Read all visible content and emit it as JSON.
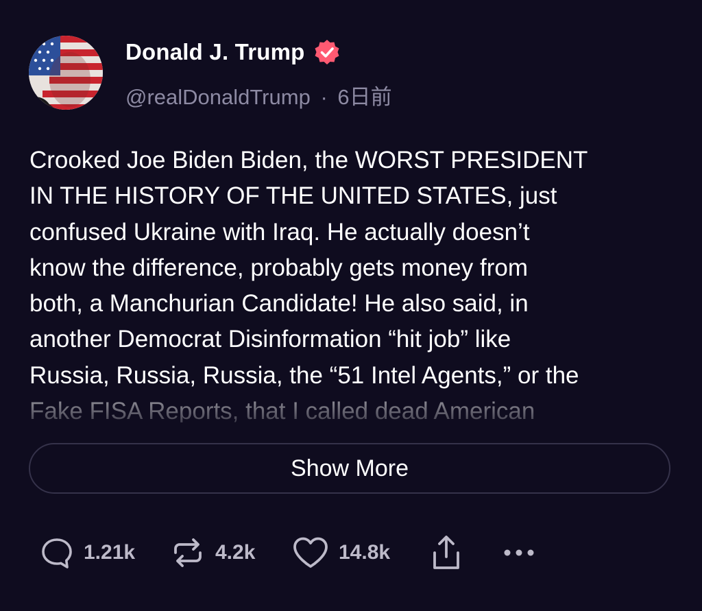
{
  "post": {
    "author_name": "Donald J. Trump",
    "handle": "@realDonaldTrump",
    "separator": "·",
    "time": "6日前",
    "body": "Crooked Joe Biden Biden, the WORST PRESIDENT\nIN THE HISTORY OF THE UNITED STATES, just\nconfused Ukraine with Iraq. He actually doesn’t\nknow the difference, probably gets money from\nboth, a Manchurian Candidate! He also said, in\nanother Democrat Disinformation “hit job” like\nRussia, Russia, Russia, the “51 Intel Agents,” or the\nFake FISA Reports, that I called dead American",
    "show_more_label": "Show More"
  },
  "actions": {
    "replies": "1.21k",
    "reposts": "4.2k",
    "likes": "14.8k"
  },
  "icons": {
    "verified": "verified-badge-icon",
    "reply": "comment-icon",
    "repost": "repost-icon",
    "like": "heart-icon",
    "share": "share-icon",
    "more": "more-dots-icon"
  },
  "colors": {
    "background": "#0f0c1f",
    "verified": "#ff5a72",
    "muted": "#8d8aa3"
  }
}
